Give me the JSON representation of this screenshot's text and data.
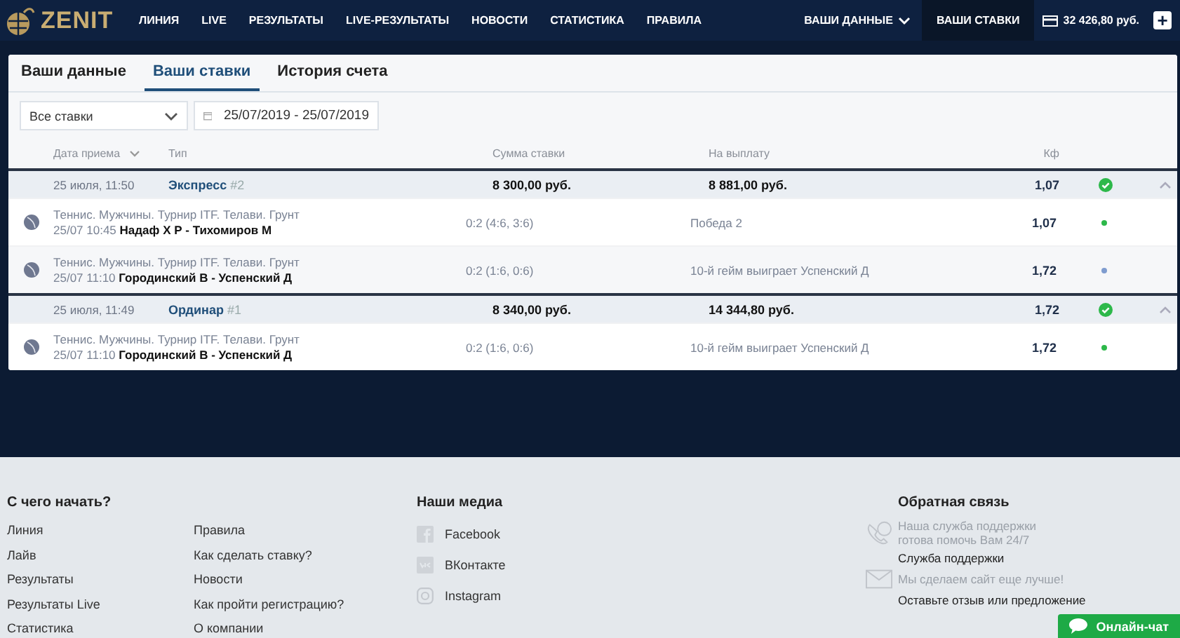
{
  "header": {
    "logo": "ZENIT",
    "nav": [
      {
        "label": "ЛИНИЯ",
        "selected": false
      },
      {
        "label": "LIVE",
        "selected": false
      },
      {
        "label": "РЕЗУЛЬТАТЫ",
        "selected": false
      },
      {
        "label": "LIVE-РЕЗУЛЬТАТЫ",
        "selected": false
      },
      {
        "label": "НОВОСТИ",
        "selected": false
      },
      {
        "label": "СТАТИСТИКА",
        "selected": false
      },
      {
        "label": "ПРАВИЛА",
        "selected": false
      }
    ],
    "account_menu": "ВАШИ ДАННЫЕ",
    "bets_link": {
      "label": "ВАШИ СТАВКИ",
      "selected": true
    },
    "balance": "32 426,80 руб.",
    "add_button": "+"
  },
  "tabs": [
    {
      "label": "Ваши данные",
      "selected": false
    },
    {
      "label": "Ваши ставки",
      "selected": true
    },
    {
      "label": "История счета",
      "selected": false
    }
  ],
  "filters": {
    "bet_type": "Все ставки",
    "date_range": "25/07/2019 - 25/07/2019"
  },
  "columns": [
    "Дата приема",
    "Тип",
    "Сумма ставки",
    "На выплату",
    "Кф"
  ],
  "bets": [
    {
      "date": "25 июля, 11:50",
      "type": "Экспресс",
      "number": "#2",
      "stake": "8 300,00 руб.",
      "payout": "8 881,00 руб.",
      "coef": "1,07",
      "color": "#2db84a",
      "expanded": true,
      "legs": [
        {
          "tournament": "Теннис. Мужчины. Турнир ITF. Телави. Грунт",
          "time": "25/07 10:45",
          "match": "Надаф Х Р - Тихомиров М",
          "score": "0:2 (4:6, 3:6)",
          "outcome": "Победа 2",
          "coef": "1,07",
          "color": "#2db84a"
        },
        {
          "tournament": "Теннис. Мужчины. Турнир ITF. Телави. Грунт",
          "time": "25/07 11:10",
          "match": "Городинский В - Успенский Д",
          "score": "0:2 (1:6, 0:6)",
          "outcome": "10-й гейм выиграет Успенский Д",
          "coef": "1,72",
          "color": "#7f9ccf"
        }
      ]
    },
    {
      "date": "25 июля, 11:49",
      "type": "Ординар",
      "number": "#1",
      "stake": "8 340,00 руб.",
      "payout": "14 344,80 руб.",
      "coef": "1,72",
      "color": "#2db84a",
      "expanded": true,
      "legs": [
        {
          "tournament": "Теннис. Мужчины. Турнир ITF. Телави. Грунт",
          "time": "25/07 11:10",
          "match": "Городинский В - Успенский Д",
          "score": "0:2 (1:6, 0:6)",
          "outcome": "10-й гейм выиграет Успенский Д",
          "coef": "1,72",
          "color": "#2db84a"
        }
      ]
    }
  ],
  "footer": {
    "start": {
      "title": "С чего начать?",
      "column_1": [
        "Линия",
        "Лайв",
        "Результаты",
        "Результаты Live",
        "Статистика"
      ],
      "column_2": [
        "Правила",
        "Как сделать ставку?",
        "Новости",
        "Как пройти регистрацию?",
        "О компании"
      ]
    },
    "media": {
      "title": "Наши медиа",
      "links": [
        {
          "kind": "facebook",
          "label": "Facebook"
        },
        {
          "kind": "vk",
          "label": "ВКонтакте"
        },
        {
          "kind": "instagram",
          "label": "Instagram"
        }
      ]
    },
    "feedback": {
      "title": "Обратная связь",
      "items": [
        {
          "kind": "phone",
          "note": "Наша служба поддержки готова помочь Вам 24/7",
          "link": "Служба поддержки"
        },
        {
          "kind": "mail",
          "note": "Мы сделаем сайт еще лучше!",
          "link": "Оставьте отзыв или предложение"
        }
      ]
    },
    "chat_button": "Онлайн-чат"
  }
}
